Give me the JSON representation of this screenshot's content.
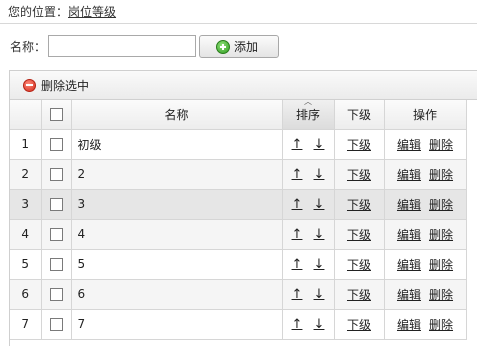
{
  "breadcrumb": {
    "prefix": "您的位置：",
    "current": "岗位等级"
  },
  "search": {
    "label": "名称：",
    "value": "",
    "placeholder": ""
  },
  "toolbar": {
    "add_label": "添加",
    "delete_selected_label": "删除选中"
  },
  "table": {
    "columns": {
      "name": "名称",
      "sort": "排序",
      "sub": "下级",
      "ops": "操作"
    },
    "sort_up": "↑",
    "sort_down": "↓",
    "sub_link": "下级",
    "edit_link": "编辑",
    "delete_link": "删除",
    "rows": [
      {
        "num": "1",
        "name": "初级"
      },
      {
        "num": "2",
        "name": "2"
      },
      {
        "num": "3",
        "name": "3"
      },
      {
        "num": "4",
        "name": "4"
      },
      {
        "num": "5",
        "name": "5"
      },
      {
        "num": "6",
        "name": "6"
      },
      {
        "num": "7",
        "name": "7"
      }
    ]
  },
  "colors": {
    "accent_add": "#2f9b1f",
    "accent_delete": "#d32b1c",
    "row_highlight": "#e6e6e6"
  },
  "icons": {
    "add": "plus-circle-icon",
    "delete": "minus-circle-icon",
    "sort": "sort-asc-icon"
  }
}
